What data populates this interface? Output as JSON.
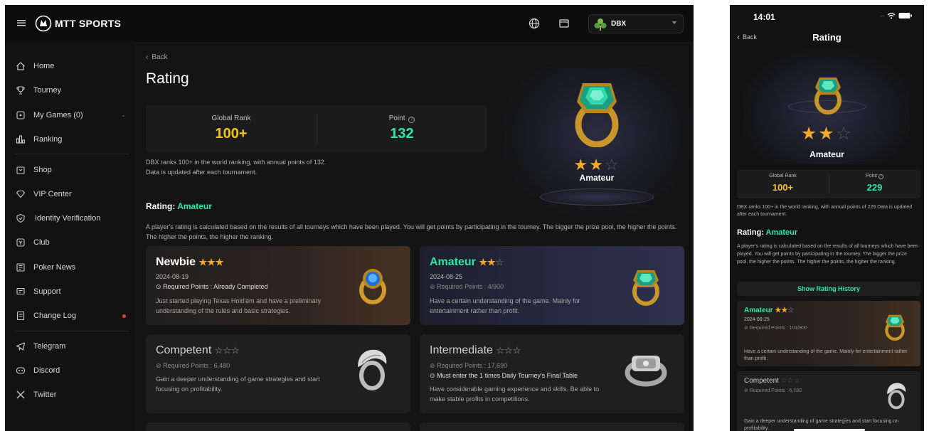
{
  "desktop": {
    "brand": "MTT SPORTS",
    "user": {
      "name": "DBX"
    },
    "sidebar": {
      "items": [
        {
          "label": "Home"
        },
        {
          "label": "Tourney"
        },
        {
          "label": "My Games (0)"
        },
        {
          "label": "Ranking"
        },
        {
          "label": "Shop"
        },
        {
          "label": "VIP Center"
        },
        {
          "label": "Identity Verification"
        },
        {
          "label": "Club"
        },
        {
          "label": "Poker News"
        },
        {
          "label": "Support"
        },
        {
          "label": "Change Log"
        },
        {
          "label": "Telegram"
        },
        {
          "label": "Discord"
        },
        {
          "label": "Twitter"
        }
      ]
    },
    "back_label": "Back",
    "page_title": "Rating",
    "stats": {
      "global_rank_label": "Global Rank",
      "global_rank_value": "100+",
      "point_label": "Point",
      "point_value": "132"
    },
    "summary_line1": "DBX ranks 100+ in the world ranking, with annual points of 132.",
    "summary_line2": "Data is updated after each tournament.",
    "hero_level": "Amateur",
    "hero_stars": 2,
    "rating_prefix": "Rating:",
    "rating_value": "Amateur",
    "rating_desc": "A player's rating is calculated based on the results of all tourneys which have been played. You will get points by participating in the tourney. The bigger the prize pool, the higher the points. The higher the points, the higher the ranking.",
    "cards": [
      {
        "title": "Newbie",
        "stars": 3,
        "date": "2024-08-19",
        "req": "Required Points : Already Completed",
        "desc": "Just started playing Texas Hold'em and have a preliminary understanding of the rules and basic strategies."
      },
      {
        "title": "Amateur",
        "stars": 2,
        "date": "2024-08-25",
        "req": "Required Points : 4/900",
        "desc": "Have a certain understanding of the game. Mainly for entertainment rather than profit."
      },
      {
        "title": "Competent",
        "stars": 0,
        "req": "Required Points : 6,480",
        "desc": "Gain a deeper understanding of game strategies and start focusing on profitability."
      },
      {
        "title": "Intermediate",
        "stars": 0,
        "req": "Required Points : 17,690",
        "extra": "Must enter the 1 times Daily Tourney's Final Table",
        "desc": "Have considerable gaming experience and skills. Be able to make stable profits in competitions."
      }
    ]
  },
  "mobile": {
    "time": "14:01",
    "back_label": "Back",
    "title": "Rating",
    "level": "Amateur",
    "stars": 2,
    "global_rank_label": "Global Rank",
    "global_rank_value": "100+",
    "point_label": "Point",
    "point_value": "229",
    "summary": "DBX ranks 100+ in the world ranking, with annual points of 229.Data is updated after each tournament.",
    "rating_prefix": "Rating:",
    "rating_value": "Amateur",
    "rating_desc": "A player's rating is calculated based on the results of all tourneys which have been played. You will get points by participating in the tourney. The bigger the prize pool, the higher the points. The higher the points, the higher the ranking.",
    "history_button": "Show Rating History",
    "cards": [
      {
        "title": "Amateur",
        "stars": 2,
        "date": "2024-08-25",
        "req": "Required Points : 101/900",
        "desc": "Have a certain understanding of the game. Mainly for entertainment rather than profit."
      },
      {
        "title": "Competent",
        "stars": 0,
        "req": "Required Points : 6,180",
        "desc": "Gain a deeper understanding of game strategies and start focusing on profitability."
      }
    ]
  },
  "colors": {
    "accent_green": "#2ee6a6",
    "gold": "#f5c518",
    "star_gold": "#f2a828",
    "alert_red": "#e5383b"
  },
  "icons": [
    "menu-icon",
    "globe-icon",
    "mail-icon",
    "caret-down-icon",
    "home-icon",
    "trophy-icon",
    "games-icon",
    "chevron-down-icon",
    "ranking-icon",
    "shop-icon",
    "vip-icon",
    "shield-icon",
    "club-icon",
    "news-icon",
    "support-icon",
    "changelog-icon",
    "telegram-icon",
    "discord-icon",
    "x-twitter-icon",
    "back-chevron-icon",
    "info-icon",
    "check-circle-icon",
    "clock-icon",
    "wifi-icon",
    "battery-icon",
    "signal-icon"
  ]
}
